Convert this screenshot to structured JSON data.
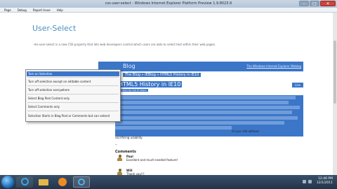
{
  "window": {
    "title": "css-user-select - Windows Internet Explorer Platform Preview 1.9.8023.6",
    "minimize": "–",
    "maximize": "□",
    "close": "✕"
  },
  "menubar": [
    "Page",
    "Debug",
    "Report Issue",
    "Help"
  ],
  "page": {
    "title": "User-Select",
    "description": "-ms-user-select is a new CSS property that lets web developers control which users are able to select text within their web pages."
  },
  "context_menu": {
    "items": [
      "Turn on Selection",
      "Turn off selection except on editable content",
      "Turn off selection everywhere",
      "Select Blog Post Content only",
      "Select Comments only",
      "Selection Starts in Blog Post or Comments but can extend"
    ],
    "highlighted_index": 0
  },
  "blog": {
    "title": "Blog",
    "tag": "The Windows Internet Explorer Weblog",
    "breadcrumb": "The Blog » IEBlog » HTML5 History in IE10",
    "post_title": "HTML5 History in IE10",
    "post_meta": "Written by the IE team",
    "like": "Like",
    "body_tail": "of your site without",
    "body_last": "sacrificing usability.",
    "dash": "–",
    "comments_heading": "Comments",
    "comments": [
      {
        "name": "Paul",
        "text": "Excellent and much-needed feature!"
      },
      {
        "name": "Will",
        "text": "Thank you!!!"
      }
    ]
  },
  "taskbar": {
    "time": "12:46 PM",
    "date": "12/1/2011"
  }
}
